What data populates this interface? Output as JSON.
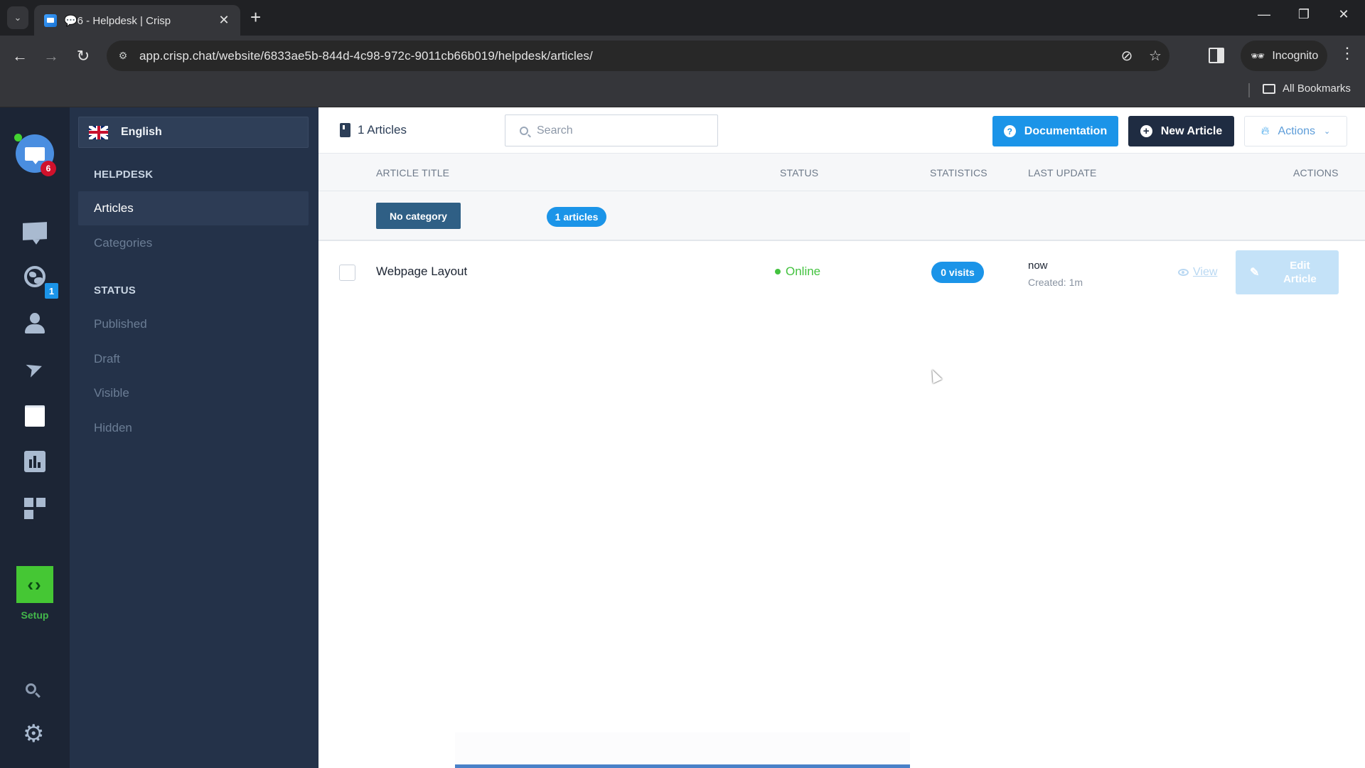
{
  "browser": {
    "tab": {
      "title": "💬6 - Helpdesk | Crisp"
    },
    "url": "app.crisp.chat/website/6833ae5b-844d-4c98-972c-9011cb66b019/helpdesk/articles/",
    "profile_label": "Incognito",
    "bookmarks_label": "All Bookmarks"
  },
  "rail": {
    "inbox_badge": "6",
    "visitors_badge": "1",
    "setup_label": "Setup",
    "accent_green": "#45c734"
  },
  "sidebar": {
    "language": "English",
    "helpdesk_title": "HELPDESK",
    "helpdesk_items": [
      {
        "label": "Articles",
        "active": true
      },
      {
        "label": "Categories",
        "active": false
      }
    ],
    "status_title": "STATUS",
    "status_items": [
      {
        "label": "Published"
      },
      {
        "label": "Draft"
      },
      {
        "label": "Visible"
      },
      {
        "label": "Hidden"
      }
    ]
  },
  "header": {
    "count_label": "1 Articles",
    "search_placeholder": "Search",
    "documentation_label": "Documentation",
    "new_article_label": "New Article",
    "actions_label": "Actions"
  },
  "table": {
    "columns": [
      "ARTICLE TITLE",
      "STATUS",
      "STATISTICS",
      "LAST UPDATE",
      "ACTIONS"
    ],
    "category": {
      "label": "No category",
      "count": "1 articles"
    },
    "rows": [
      {
        "title": "Webpage Layout",
        "status": "Online",
        "visits": "0 visits",
        "last_update": "now",
        "created": "Created: 1m",
        "view_label": "View",
        "edit_label": "Edit Article"
      }
    ]
  },
  "colors": {
    "primary_blue": "#1b94e8",
    "dark_navy": "#1f2c42",
    "online_green": "#43c23f"
  }
}
